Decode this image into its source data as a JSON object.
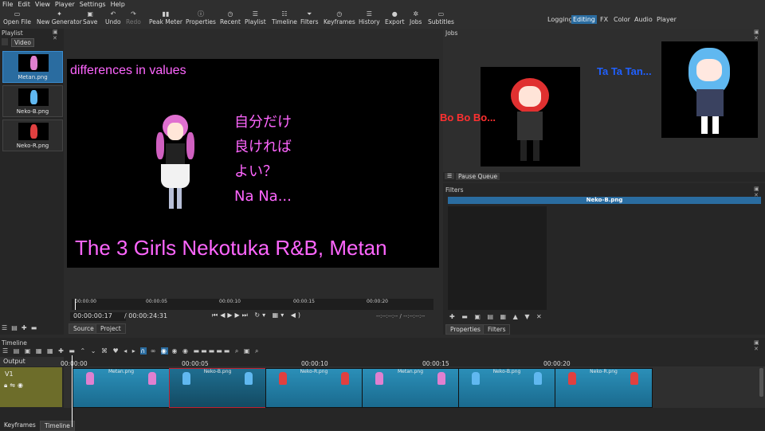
{
  "menu": [
    "File",
    "Edit",
    "View",
    "Player",
    "Settings",
    "Help"
  ],
  "toolbar": [
    {
      "label": "Open File",
      "icon": "open-file-icon",
      "glyph": "▭",
      "enabled": true
    },
    {
      "label": "New Generator",
      "icon": "new-generator-icon",
      "glyph": "✦",
      "enabled": true
    },
    {
      "label": "Save",
      "icon": "save-icon",
      "glyph": "▣",
      "enabled": true
    },
    {
      "label": "Undo",
      "icon": "undo-icon",
      "glyph": "↶",
      "enabled": true
    },
    {
      "label": "Redo",
      "icon": "redo-icon",
      "glyph": "↷",
      "enabled": false
    },
    {
      "label": "Peak Meter",
      "icon": "peak-meter-icon",
      "glyph": "▮▮",
      "enabled": true
    },
    {
      "label": "Properties",
      "icon": "properties-icon",
      "glyph": "ⓘ",
      "enabled": true
    },
    {
      "label": "Recent",
      "icon": "recent-icon",
      "glyph": "◷",
      "enabled": true
    },
    {
      "label": "Playlist",
      "icon": "playlist-icon",
      "glyph": "☰",
      "enabled": true
    },
    {
      "label": "Timeline",
      "icon": "timeline-icon",
      "glyph": "☷",
      "enabled": true
    },
    {
      "label": "Filters",
      "icon": "filters-icon",
      "glyph": "⏷",
      "enabled": true
    },
    {
      "label": "Keyframes",
      "icon": "keyframes-icon",
      "glyph": "◷",
      "enabled": true
    },
    {
      "label": "History",
      "icon": "history-icon",
      "glyph": "☰",
      "enabled": true
    },
    {
      "label": "Export",
      "icon": "export-icon",
      "glyph": "●",
      "enabled": true
    },
    {
      "label": "Jobs",
      "icon": "jobs-icon",
      "glyph": "✲",
      "enabled": true
    },
    {
      "label": "Subtitles",
      "icon": "subtitles-icon",
      "glyph": "▭",
      "enabled": true
    }
  ],
  "workspaces": [
    {
      "label": "Logging",
      "active": false
    },
    {
      "label": "Editing",
      "active": true
    },
    {
      "label": "FX",
      "active": false
    },
    {
      "label": "Color",
      "active": false
    },
    {
      "label": "Audio",
      "active": false
    },
    {
      "label": "Player",
      "active": false
    }
  ],
  "playlist": {
    "title": "Playlist",
    "filter": "Video",
    "items": [
      {
        "name": "Metan.png"
      },
      {
        "name": "Neko-B.png"
      },
      {
        "name": "Neko-R.png"
      }
    ]
  },
  "viewer": {
    "top_text": "differences in values",
    "jp_lines": [
      "自分だけ",
      "良ければ",
      "よい？",
      "Na Na..."
    ],
    "bottom_text": "The 3 Girls Nekotuka R&B, Metan",
    "ruler": [
      "00:00:00",
      "00:00:05",
      "00:00:10",
      "00:00:15",
      "00:00:20"
    ],
    "timecode": "00:00:00:17",
    "duration": "00:00:24:31",
    "in_out": "--:--:--:-- / --:--:--:--",
    "tabs": [
      "Source",
      "Project"
    ]
  },
  "jobs": {
    "title": "Jobs",
    "bubble_left": "Bo Bo Bo...",
    "bubble_right": "Ta Ta Tan...",
    "pause_label": "Pause Queue"
  },
  "filters": {
    "title": "Filters",
    "selected": "Neko-B.png",
    "tabs": [
      "Properties",
      "Filters"
    ]
  },
  "timeline": {
    "title": "Timeline",
    "output_label": "Output",
    "track": "V1",
    "ruler": [
      "00:00:00",
      "00:00:05",
      "00:00:10",
      "00:00:15",
      "00:00:20"
    ],
    "clips": [
      "Metan.png",
      "Neko-B.png",
      "Neko-R.png",
      "Metan.png",
      "Neko-B.png",
      "Neko-R.png"
    ]
  },
  "bottom_tabs": [
    "Keyframes",
    "Timeline"
  ],
  "colors": {
    "accent": "#2a6ca0",
    "overlay_text": "#ff66ff",
    "clip": "#2b8fb8",
    "bo_text": "#ff3030",
    "ta_text": "#2060ff"
  }
}
